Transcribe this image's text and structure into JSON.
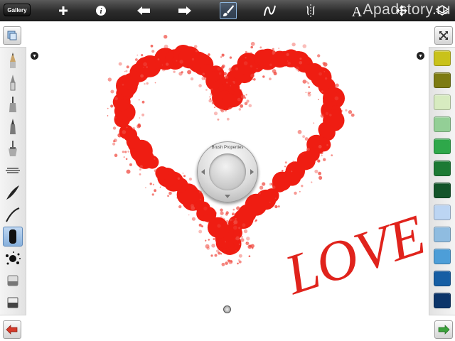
{
  "toolbar": {
    "gallery_label": "Gallery",
    "icons": [
      "add-icon",
      "info-icon",
      "undo-icon",
      "redo-icon",
      "brush-icon",
      "stroke-icon",
      "symmetry-icon",
      "text-icon",
      "transform-icon",
      "layers-icon"
    ],
    "selected": "brush-icon"
  },
  "watermark": "Apadstory.ru",
  "left_panel": {
    "brushes": [
      "pencil",
      "ballpoint",
      "marker",
      "fine-pen",
      "paint-brush",
      "airbrush",
      "feather-brush",
      "smudge",
      "selected-brush",
      "splatter",
      "eraser",
      "hard-eraser"
    ],
    "selected": "selected-brush"
  },
  "right_panel": {
    "colors": [
      "#c9c21a",
      "#7d7b12",
      "#d7ebc0",
      "#93cf96",
      "#2ea84a",
      "#1c7a34",
      "#13542a",
      "#bcd5f3",
      "#8fbce0",
      "#4d9ed8",
      "#165ea4",
      "#0c356a"
    ]
  },
  "brush_properties_label": "Brush Properties",
  "canvas_text": "LOVE"
}
